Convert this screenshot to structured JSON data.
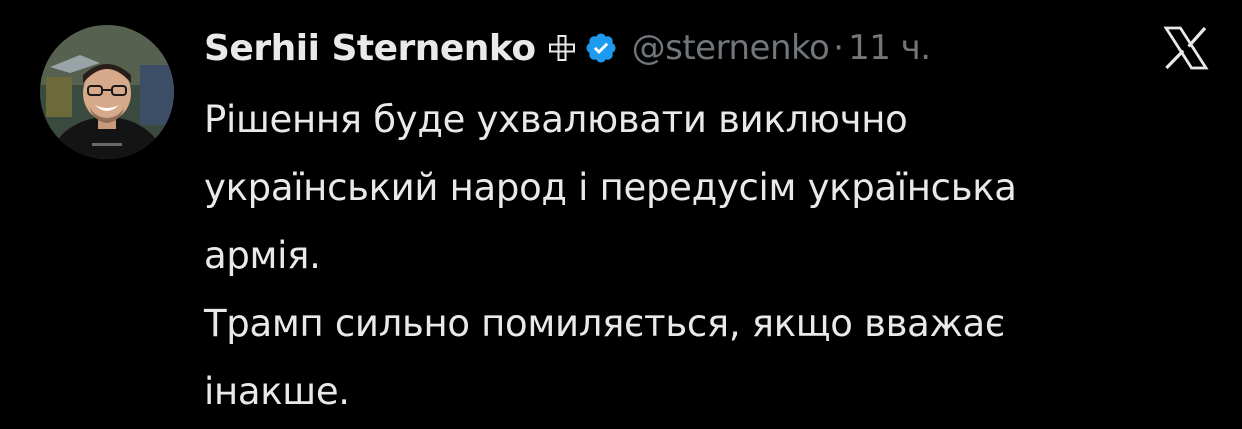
{
  "tweet": {
    "author": {
      "display_name": "Serhii Sternenko",
      "badge_icon": "plus-icon",
      "verified_icon": "verified-badge-icon",
      "handle": "@sternenko",
      "separator": "·",
      "time": "11 ч."
    },
    "platform_icon": "x-logo-icon",
    "text_lines": [
      "Рішення буде ухвалювати виключно",
      "український народ і передусім українська",
      "армія.",
      "Трамп сильно помиляється, якщо вважає",
      "інакше."
    ]
  },
  "colors": {
    "background": "#000000",
    "text": "#e7e9ea",
    "muted": "#71767b",
    "verified": "#1d9bf0"
  }
}
